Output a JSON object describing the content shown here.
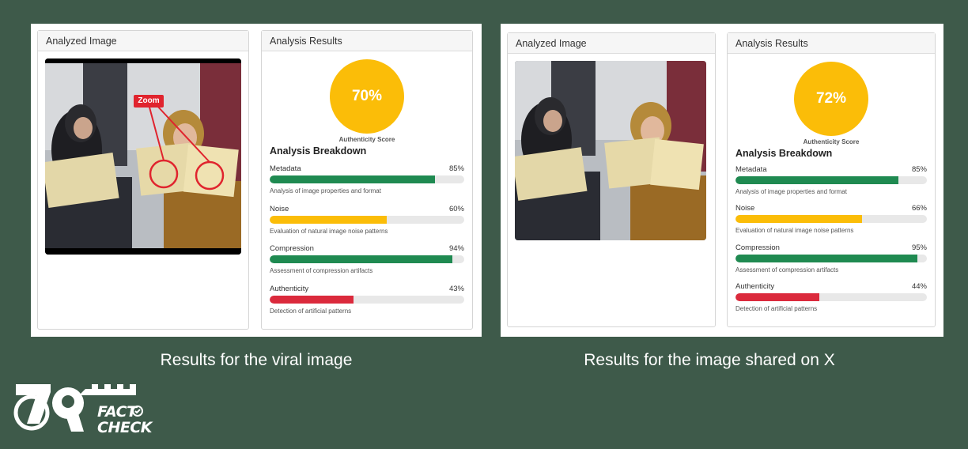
{
  "panels": [
    {
      "caption": "Results for the viral image",
      "analyzed_title": "Analyzed Image",
      "zoom_label": "Zoom",
      "results_title": "Analysis Results",
      "score": "70%",
      "score_label": "Authenticity Score",
      "breakdown_title": "Analysis Breakdown",
      "metrics": [
        {
          "name": "Metadata",
          "value": "85%",
          "fraction": 0.85,
          "color": "#1f8a51",
          "desc": "Analysis of image properties and format"
        },
        {
          "name": "Noise",
          "value": "60%",
          "fraction": 0.6,
          "color": "#fbbd08",
          "desc": "Evaluation of natural image noise patterns"
        },
        {
          "name": "Compression",
          "value": "94%",
          "fraction": 0.94,
          "color": "#1f8a51",
          "desc": "Assessment of compression artifacts"
        },
        {
          "name": "Authenticity",
          "value": "43%",
          "fraction": 0.43,
          "color": "#db2a3c",
          "desc": "Detection of artificial patterns"
        }
      ]
    },
    {
      "caption": "Results for the image shared on X",
      "analyzed_title": "Analyzed Image",
      "results_title": "Analysis Results",
      "score": "72%",
      "score_label": "Authenticity Score",
      "breakdown_title": "Analysis Breakdown",
      "metrics": [
        {
          "name": "Metadata",
          "value": "85%",
          "fraction": 0.85,
          "color": "#1f8a51",
          "desc": "Analysis of image properties and format"
        },
        {
          "name": "Noise",
          "value": "66%",
          "fraction": 0.66,
          "color": "#fbbd08",
          "desc": "Evaluation of natural image noise patterns"
        },
        {
          "name": "Compression",
          "value": "95%",
          "fraction": 0.95,
          "color": "#1f8a51",
          "desc": "Assessment of compression artifacts"
        },
        {
          "name": "Authenticity",
          "value": "44%",
          "fraction": 0.44,
          "color": "#db2a3c",
          "desc": "Detection of artificial patterns"
        }
      ]
    }
  ],
  "logo": {
    "number": "79",
    "line1": "FACT",
    "line2": "CHECK"
  },
  "colors": {
    "background": "#3e5a4a",
    "score_circle": "#fbbd08",
    "good": "#1f8a51",
    "medium": "#fbbd08",
    "bad": "#db2a3c"
  }
}
